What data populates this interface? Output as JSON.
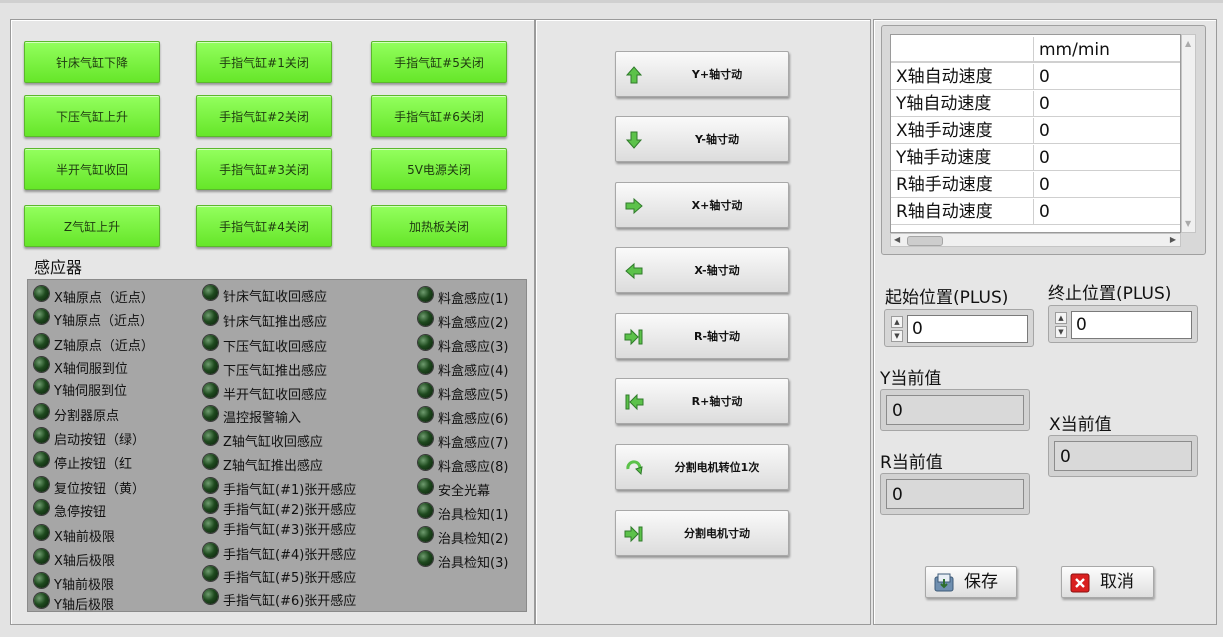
{
  "left_panel": {
    "buttons": [
      {
        "label": "针床气缸下降"
      },
      {
        "label": "手指气缸#1关闭"
      },
      {
        "label": "手指气缸#5关闭"
      },
      {
        "label": "下压气缸上升"
      },
      {
        "label": "手指气缸#2关闭"
      },
      {
        "label": "手指气缸#6关闭"
      },
      {
        "label": "半开气缸收回"
      },
      {
        "label": "手指气缸#3关闭"
      },
      {
        "label": "5V电源关闭"
      },
      {
        "label": "Z气缸上升"
      },
      {
        "label": "手指气缸#4关闭"
      },
      {
        "label": "加热板关闭"
      }
    ],
    "sensor_title": "感应器",
    "sensors_col1": [
      "X轴原点（近点）",
      "Y轴原点（近点）",
      "Z轴原点（近点）",
      "X轴伺服到位",
      "Y轴伺服到位",
      "分割器原点",
      "启动按钮（绿）",
      "停止按钮（红",
      "复位按钮（黄）",
      "急停按钮",
      "X轴前极限",
      "X轴后极限",
      "Y轴前极限",
      "Y轴后极限"
    ],
    "sensors_col2": [
      "针床气缸收回感应",
      "针床气缸推出感应",
      "下压气缸收回感应",
      "下压气缸推出感应",
      "半开气缸收回感应",
      "温控报警输入",
      "Z轴气缸收回感应",
      "Z轴气缸推出感应",
      "手指气缸(#1)张开感应",
      "手指气缸(#2)张开感应",
      "手指气缸(#3)张开感应",
      "手指气缸(#4)张开感应",
      "手指气缸(#5)张开感应",
      "手指气缸(#6)张开感应"
    ],
    "sensors_col3": [
      "料盒感应(1)",
      "料盒感应(2)",
      "料盒感应(3)",
      "料盒感应(4)",
      "料盒感应(5)",
      "料盒感应(6)",
      "料盒感应(7)",
      "料盒感应(8)",
      "安全光幕",
      "治具检知(1)",
      "治具检知(2)",
      "治具检知(3)"
    ]
  },
  "middle_panel": {
    "jog_buttons": [
      {
        "label": "Y+轴寸动",
        "icon": "arrow-up-icon"
      },
      {
        "label": "Y-轴寸动",
        "icon": "arrow-down-icon"
      },
      {
        "label": "X+轴寸动",
        "icon": "arrow-right-icon"
      },
      {
        "label": "X-轴寸动",
        "icon": "arrow-left-icon"
      },
      {
        "label": "R-轴寸动",
        "icon": "arrow-right-bar-icon"
      },
      {
        "label": "R+轴寸动",
        "icon": "arrow-left-bar-icon"
      },
      {
        "label": "分割电机转位1次",
        "icon": "rotate-icon"
      },
      {
        "label": "分割电机寸动",
        "icon": "arrow-right-bar-icon"
      }
    ]
  },
  "right_panel": {
    "table": {
      "header": [
        "",
        "mm/min"
      ],
      "rows": [
        [
          "X轴自动速度",
          "0"
        ],
        [
          "Y轴自动速度",
          "0"
        ],
        [
          "X轴手动速度",
          "0"
        ],
        [
          "Y轴手动速度",
          "0"
        ],
        [
          "R轴手动速度",
          "0"
        ],
        [
          "R轴自动速度",
          "0"
        ]
      ]
    },
    "start_pos": {
      "label": "起始位置(PLUS)",
      "value": "0"
    },
    "end_pos": {
      "label": "终止位置(PLUS)",
      "value": "0"
    },
    "y_current": {
      "label": "Y当前值",
      "value": "0"
    },
    "x_current": {
      "label": "X当前值",
      "value": "0"
    },
    "r_current": {
      "label": "R当前值",
      "value": "0"
    },
    "save_label": "保存",
    "cancel_label": "取消"
  },
  "colors": {
    "green_button": "#7cf443",
    "led_off": "#1e4a1e",
    "panel_bg": "#e6e6e6",
    "sensor_bg": "#a6a6a6"
  }
}
